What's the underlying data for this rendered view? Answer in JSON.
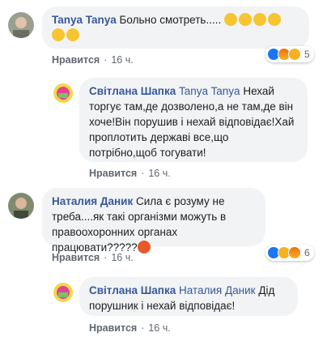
{
  "comments": [
    {
      "author": "Tanya Tanya",
      "text": "Больно смотреть.....",
      "emoji": [
        "pensive-face-icon",
        "pensive-face-icon",
        "pensive-face-icon",
        "pensive-face-icon",
        "pensive-face-icon",
        "pensive-face-icon"
      ],
      "like_label": "Нравится",
      "time": "16 ч.",
      "reaction_count": "5"
    },
    {
      "author": "Світлана Шапка",
      "mention": "Tanya Tanya",
      "text": "Нехай торгує там,де дозволено,а не там,де він хоче!Він порушив і нехай відповідає!Хай проплотить державі все,що потрібно,щоб тогувати!",
      "like_label": "Нравится",
      "time": "16 ч."
    },
    {
      "author": "Наталия Даник",
      "text": "Сила є розуму не треба....як такі організми можуть в правоохоронних органах працювати?????",
      "emoji": [
        "angry-face-icon"
      ],
      "like_label": "Нравится",
      "time": "16 ч.",
      "reaction_count": "6"
    },
    {
      "author": "Світлана Шапка",
      "mention": "Наталия Даник",
      "text": "Дід порушник і нехай відповідає!",
      "like_label": "Нравится",
      "time": "16 ч."
    }
  ],
  "colors": {
    "author": "#385898",
    "bubble": "#f2f3f5",
    "meta": "#606770",
    "like": "#1877f2"
  }
}
